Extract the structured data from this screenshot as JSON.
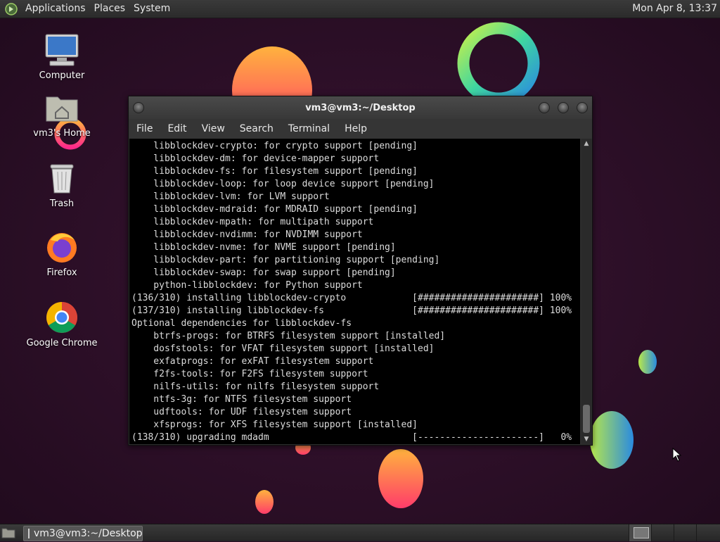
{
  "top_panel": {
    "menus": [
      "Applications",
      "Places",
      "System"
    ],
    "clock": "Mon Apr  8, 13:37"
  },
  "desktop_icons": [
    {
      "label": "Computer",
      "icon": "computer-icon"
    },
    {
      "label": "vm3's Home",
      "icon": "home-folder-icon"
    },
    {
      "label": "Trash",
      "icon": "trash-icon"
    },
    {
      "label": "Firefox",
      "icon": "firefox-icon"
    },
    {
      "label": "Google Chrome",
      "icon": "chrome-icon"
    }
  ],
  "terminal": {
    "title": "vm3@vm3:~/Desktop",
    "menus": [
      "File",
      "Edit",
      "View",
      "Search",
      "Terminal",
      "Help"
    ],
    "lines": [
      "    libblockdev-crypto: for crypto support [pending]",
      "    libblockdev-dm: for device-mapper support",
      "    libblockdev-fs: for filesystem support [pending]",
      "    libblockdev-loop: for loop device support [pending]",
      "    libblockdev-lvm: for LVM support",
      "    libblockdev-mdraid: for MDRAID support [pending]",
      "    libblockdev-mpath: for multipath support",
      "    libblockdev-nvdimm: for NVDIMM support",
      "    libblockdev-nvme: for NVME support [pending]",
      "    libblockdev-part: for partitioning support [pending]",
      "    libblockdev-swap: for swap support [pending]",
      "    python-libblockdev: for Python support",
      "(136/310) installing libblockdev-crypto            [######################] 100%",
      "(137/310) installing libblockdev-fs                [######################] 100%",
      "Optional dependencies for libblockdev-fs",
      "    btrfs-progs: for BTRFS filesystem support [installed]",
      "    dosfstools: for VFAT filesystem support [installed]",
      "    exfatprogs: for exFAT filesystem support",
      "    f2fs-tools: for F2FS filesystem support",
      "    nilfs-utils: for nilfs filesystem support",
      "    ntfs-3g: for NTFS filesystem support",
      "    udftools: for UDF filesystem support",
      "    xfsprogs: for XFS filesystem support [installed]",
      "(138/310) upgrading mdadm                          [----------------------]   0%"
    ]
  },
  "taskbar": {
    "window_button": "vm3@vm3:~/Desktop"
  }
}
